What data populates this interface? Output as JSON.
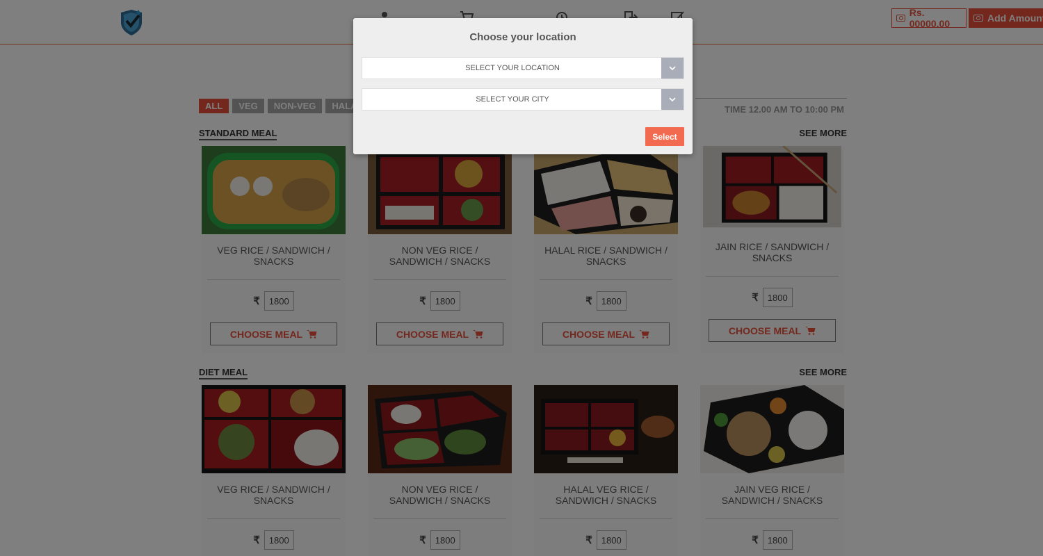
{
  "header": {
    "wallet_amount": "Rs. 00000.00",
    "add_amount_label": "Add Amount",
    "nav_icons": [
      "user-icon",
      "cart-icon",
      "history-icon",
      "logout-icon",
      "edit-icon"
    ]
  },
  "filters": {
    "tabs": [
      {
        "label": "ALL",
        "active": true
      },
      {
        "label": "VEG",
        "active": false
      },
      {
        "label": "NON-VEG",
        "active": false
      },
      {
        "label": "HALA",
        "active": false
      }
    ],
    "time_text": "TIME 12.00 AM TO 10:00 PM"
  },
  "sections": [
    {
      "title": "STANDARD MEAL",
      "see_more": "SEE MORE",
      "cards": [
        {
          "name": "VEG RICE / SANDWICH / SNACKS",
          "price": "1800",
          "button": "CHOOSE MEAL"
        },
        {
          "name": "NON VEG RICE / SANDWICH / SNACKS",
          "price": "1800",
          "button": "CHOOSE MEAL"
        },
        {
          "name": "HALAL RICE / SANDWICH / SNACKS",
          "price": "1800",
          "button": "CHOOSE MEAL"
        },
        {
          "name": "JAIN RICE / SANDWICH / SNACKS",
          "price": "1800",
          "button": "CHOOSE MEAL"
        }
      ]
    },
    {
      "title": "DIET MEAL",
      "see_more": "SEE MORE",
      "cards": [
        {
          "name": "VEG RICE / SANDWICH / SNACKS",
          "price": "1800",
          "button": "CHOOSE MEAL"
        },
        {
          "name": "NON VEG RICE / SANDWICH / SNACKS",
          "price": "1800",
          "button": "CHOOSE MEAL"
        },
        {
          "name": "HALAL VEG RICE / SANDWICH / SNACKS",
          "price": "1800",
          "button": "CHOOSE MEAL"
        },
        {
          "name": "JAIN VEG RICE / SANDWICH / SNACKS",
          "price": "1800",
          "button": "CHOOSE MEAL"
        }
      ]
    }
  ],
  "currency_symbol": "₹",
  "modal": {
    "title": "Choose your location",
    "location_select": "SELECT YOUR LOCATION",
    "city_select": "SELECT YOUR CITY",
    "select_button": "Select"
  },
  "colors": {
    "accent": "#e8503a",
    "select_button": "#f26b50"
  }
}
